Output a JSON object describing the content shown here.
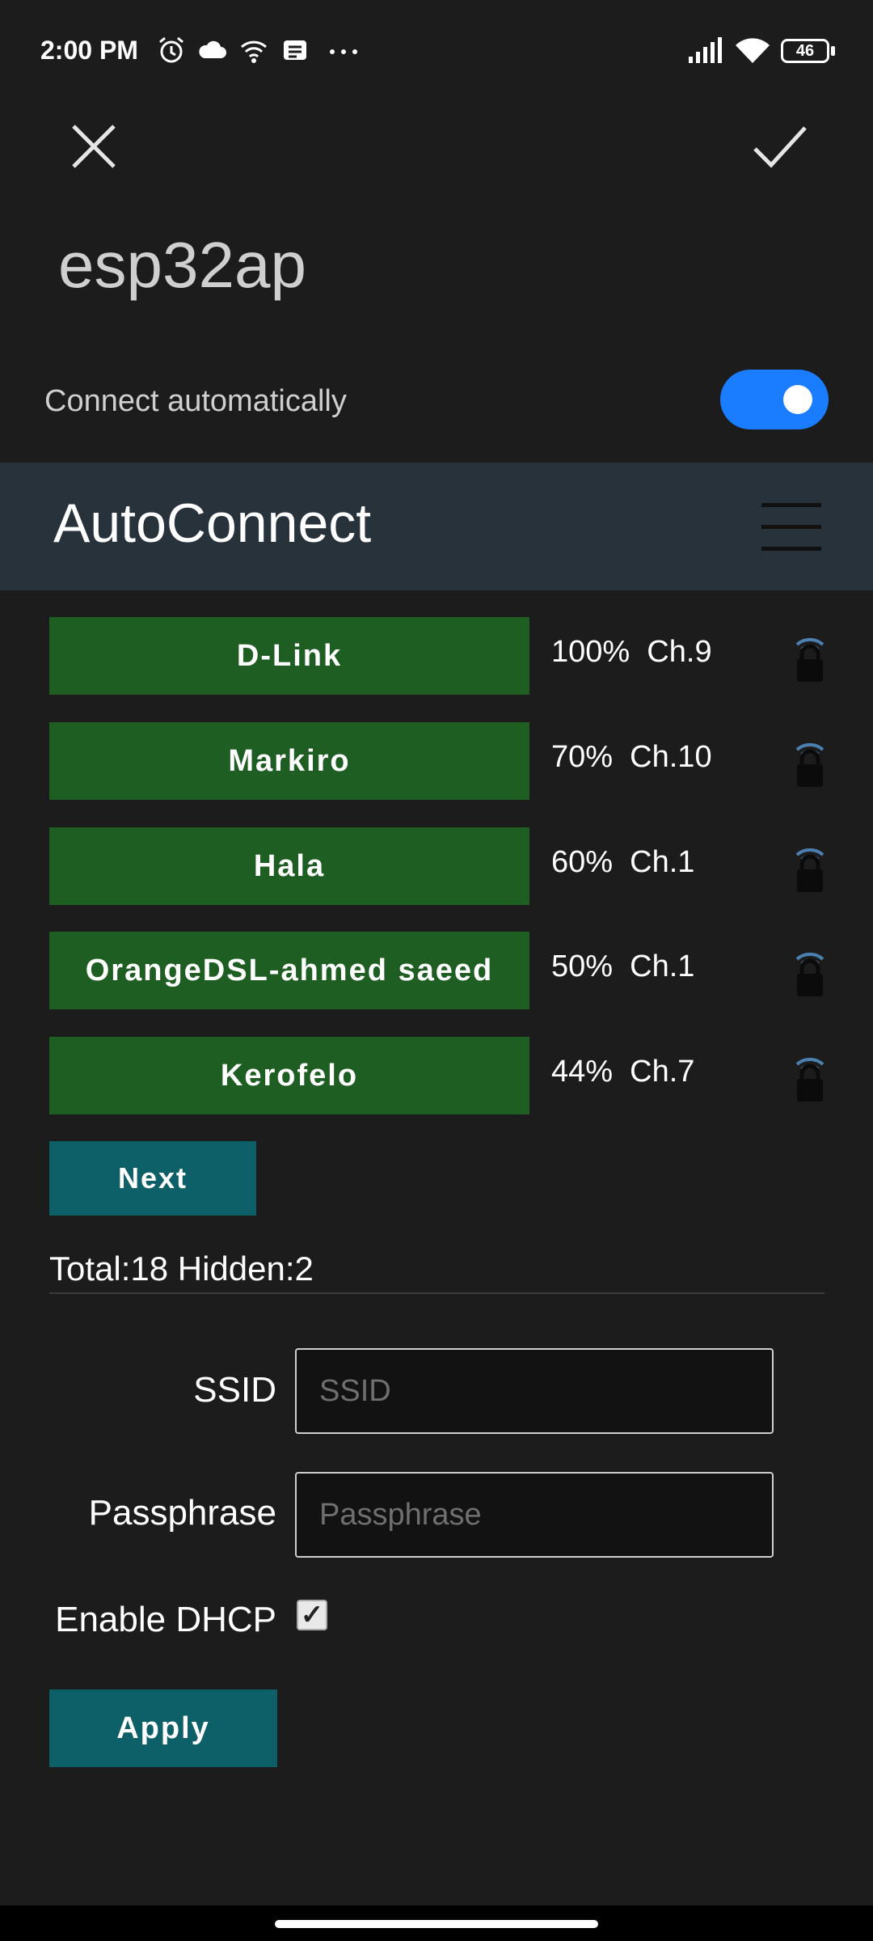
{
  "status_bar": {
    "time": "2:00 PM",
    "battery": "46",
    "icons": [
      "alarm-icon",
      "cloud-icon",
      "wifi-hotspot-icon",
      "notification-icon",
      "more-icon",
      "signal-icon",
      "wifi-icon",
      "battery-icon"
    ]
  },
  "header": {
    "title": "esp32ap",
    "auto_connect_label": "Connect automatically",
    "auto_connect_on": true
  },
  "portal": {
    "title": "AutoConnect",
    "networks": [
      {
        "ssid": "D-Link",
        "info": "100%  Ch.9"
      },
      {
        "ssid": "Markiro",
        "info": "70%  Ch.10"
      },
      {
        "ssid": "Hala",
        "info": "60%  Ch.1"
      },
      {
        "ssid": "OrangeDSL-ahmed saeed",
        "info": "50%  Ch.1"
      },
      {
        "ssid": "Kerofelo",
        "info": "44%  Ch.7"
      }
    ],
    "next_label": "Next",
    "total_text": "Total:18 Hidden:2",
    "form": {
      "ssid_label": "SSID",
      "ssid_placeholder": "SSID",
      "pass_label": "Passphrase",
      "pass_placeholder": "Passphrase",
      "dhcp_label": "Enable DHCP",
      "dhcp_checked": true,
      "apply_label": "Apply"
    }
  },
  "colors": {
    "network_button": "#1f5e23",
    "action_button": "#0d5f68",
    "toggle_on": "#1a7dff",
    "portal_bar": "#28323b"
  }
}
